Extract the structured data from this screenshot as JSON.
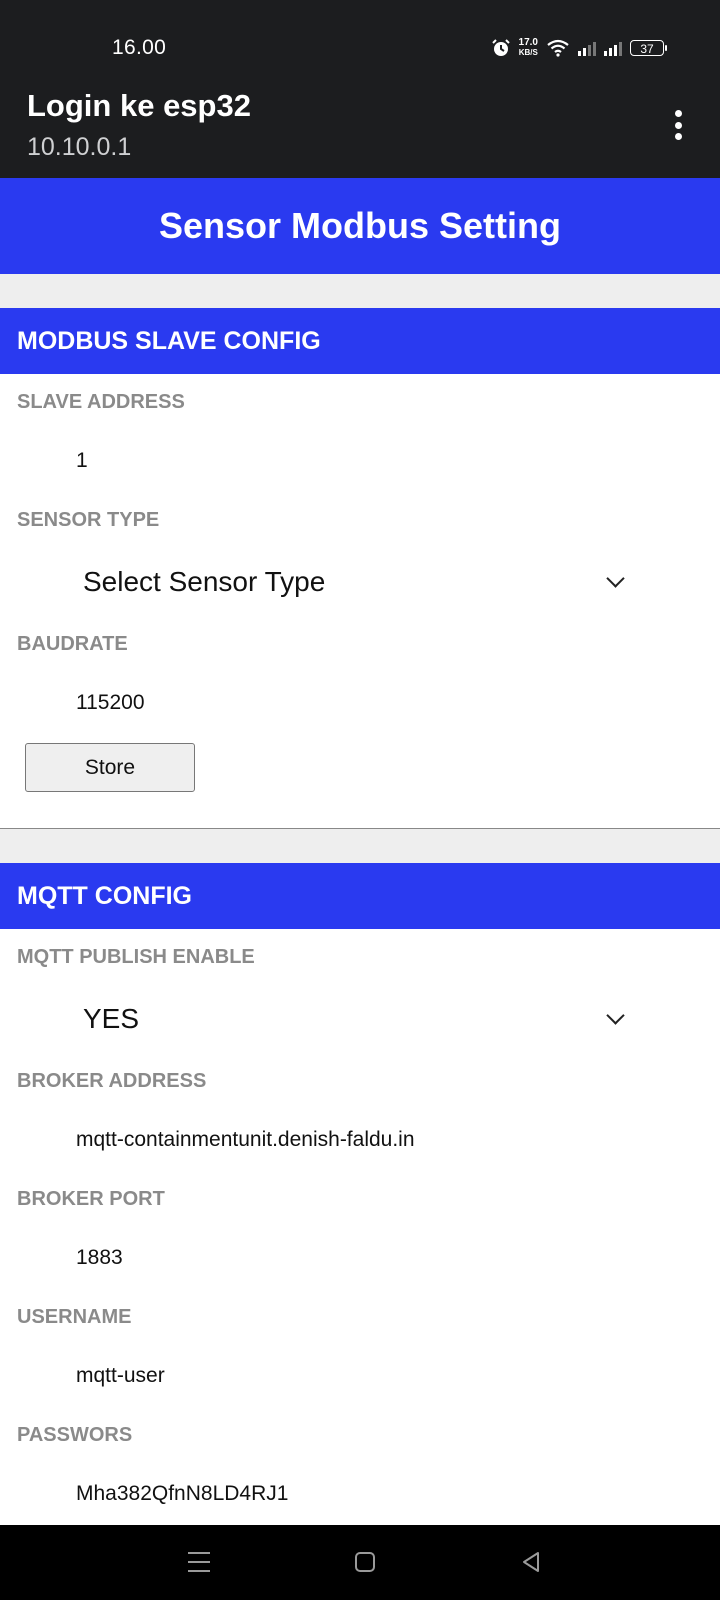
{
  "status_bar": {
    "time": "16.00",
    "net_speed_value": "17.0",
    "net_speed_unit": "KB/S",
    "battery": "37",
    "icons": [
      "alarm-icon",
      "wifi-icon",
      "signal-icon",
      "signal-icon",
      "battery-icon"
    ]
  },
  "app_bar": {
    "title": "Login ke esp32",
    "subtitle": "10.10.0.1",
    "menu_icon": "more-vert-icon"
  },
  "page": {
    "title": "Sensor Modbus Setting"
  },
  "modbus": {
    "header": "MODBUS SLAVE CONFIG",
    "slave_address_label": "SLAVE ADDRESS",
    "slave_address_value": "1",
    "sensor_type_label": "SENSOR TYPE",
    "sensor_type_selected": "Select Sensor Type",
    "baudrate_label": "BAUDRATE",
    "baudrate_value": "115200",
    "store_label": "Store"
  },
  "mqtt": {
    "header": "MQTT CONFIG",
    "publish_enable_label": "MQTT PUBLISH ENABLE",
    "publish_enable_selected": "YES",
    "broker_address_label": "BROKER ADDRESS",
    "broker_address_value": "mqtt-containmentunit.denish-faldu.in",
    "broker_port_label": "BROKER PORT",
    "broker_port_value": "1883",
    "username_label": "USERNAME",
    "username_value": "mqtt-user",
    "password_label": "PASSWORS",
    "password_value": "Mha382QfnN8LD4RJ1"
  },
  "nav_bar": {
    "icons": [
      "menu-icon",
      "home-icon",
      "back-icon"
    ]
  },
  "colors": {
    "accent": "#2a3af0",
    "system_bar": "#1c1d1f",
    "label_gray": "#8a8a8a"
  }
}
